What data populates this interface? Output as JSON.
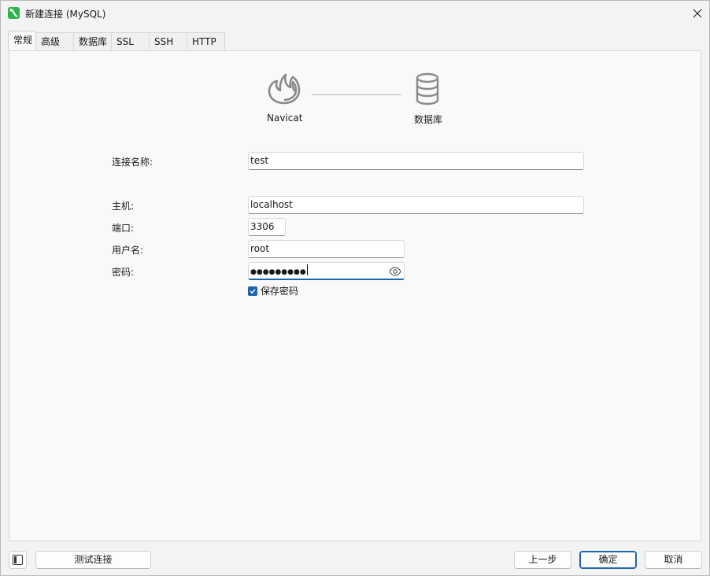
{
  "window": {
    "title": "新建连接 (MySQL)"
  },
  "tabs": [
    {
      "label": "常规",
      "active": true
    },
    {
      "label": "高级",
      "active": false
    },
    {
      "label": "数据库",
      "active": false
    },
    {
      "label": "SSL",
      "active": false
    },
    {
      "label": "SSH",
      "active": false
    },
    {
      "label": "HTTP",
      "active": false
    }
  ],
  "diagram": {
    "left_node": {
      "label": "Navicat",
      "icon": "navicat-logo-icon"
    },
    "right_node": {
      "label": "数据库",
      "icon": "database-icon"
    }
  },
  "form": {
    "connection_name": {
      "label": "连接名称:",
      "value": "test"
    },
    "host": {
      "label": "主机:",
      "value": "localhost"
    },
    "port": {
      "label": "端口:",
      "value": "3306"
    },
    "username": {
      "label": "用户名:",
      "value": "root"
    },
    "password": {
      "label": "密码:",
      "value": "●●●●●●●●●",
      "icon": "eye-icon"
    },
    "save_password": {
      "label": "保存密码",
      "checked": true
    }
  },
  "footer": {
    "test_connection": "测试连接",
    "previous": "上一步",
    "ok": "确定",
    "cancel": "取消"
  },
  "colors": {
    "accent": "#1d64b0",
    "app_icon": "#2fb34a"
  }
}
